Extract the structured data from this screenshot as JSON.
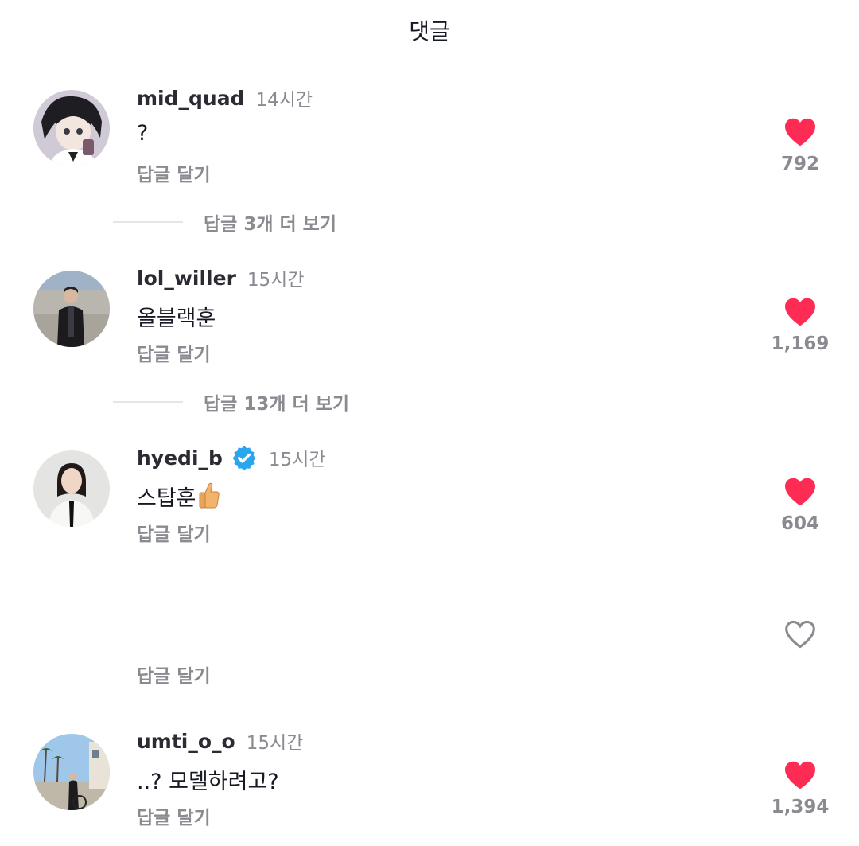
{
  "header": {
    "title": "댓글"
  },
  "comments": [
    {
      "username": "mid_quad",
      "time": "14시간",
      "text": "?",
      "reply_label": "답글 달기",
      "likes": "792",
      "liked": true,
      "more_replies": "답글 3개 더 보기",
      "verified": false
    },
    {
      "username": "lol_willer",
      "time": "15시간",
      "text": "올블랙훈",
      "reply_label": "답글 달기",
      "likes": "1,169",
      "liked": true,
      "more_replies": "답글 13개 더 보기",
      "verified": false
    },
    {
      "username": "hyedi_b",
      "time": "15시간",
      "text": "스탑훈",
      "reply_label": "답글 달기",
      "likes": "604",
      "liked": true,
      "verified": true
    },
    {
      "username": "",
      "time": "",
      "text": "",
      "reply_label": "답글 달기",
      "likes": "",
      "liked": false
    },
    {
      "username": "umti_o_o",
      "time": "15시간",
      "text": "..? 모델하려고?",
      "reply_label": "답글 달기",
      "likes": "1,394",
      "liked": true,
      "verified": false
    }
  ],
  "colors": {
    "heart_filled": "#fe2c55",
    "heart_outline": "#8a8b91",
    "verified_badge": "#20d5ec",
    "muted_text": "#8a8b91"
  },
  "icons": {
    "like": "heart-icon",
    "verified": "verified-badge-icon",
    "emoji": "thumbs-up-emoji"
  }
}
